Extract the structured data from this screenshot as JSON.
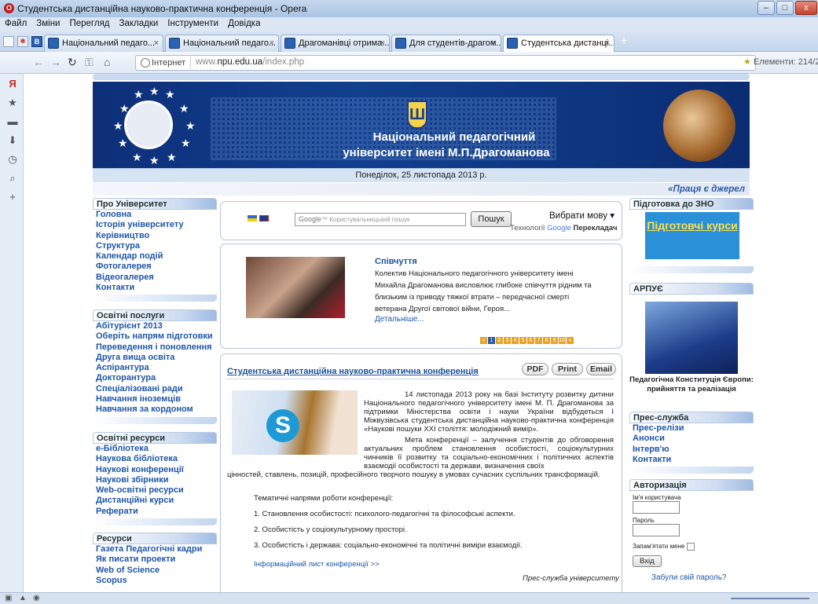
{
  "window": {
    "title": "Студентська дистанційна науково-практична конференція - Opera",
    "controls": [
      "–",
      "□",
      "x"
    ]
  },
  "menu": [
    "Файл",
    "Зміни",
    "Перегляд",
    "Закладки",
    "Інструменти",
    "Довідка"
  ],
  "tabs": [
    {
      "label": "Національний педаго...",
      "active": false
    },
    {
      "label": "Національний педаго...",
      "active": false
    },
    {
      "label": "Драгоманівці отрима...",
      "active": false
    },
    {
      "label": "Для студентів-драгом...",
      "active": false
    },
    {
      "label": "Студентська дистанці...",
      "active": true
    }
  ],
  "address": {
    "security_label": "Інтернет",
    "url_prefix": "www.",
    "url_domain": "npu.edu.ua",
    "url_path": "/index.php",
    "elements_label": "Елементи: 214/2"
  },
  "site": {
    "university_line1": "Національний педагогічний",
    "university_line2": "університет імені М.П.Драгоманова",
    "date": "Понеділок, 25 листопада 2013 р.",
    "ticker": "«Праця є джерел"
  },
  "left_blocks": [
    {
      "title": "Про Університет",
      "links": [
        "Головна",
        "Історія університету",
        "Керівництво",
        "Структура",
        "Календар подій",
        "Фотогалерея",
        "Відеогалерея",
        "Контакти"
      ]
    },
    {
      "title": "Освітні послуги",
      "links": [
        "Абітурієнт 2013",
        "Оберіть напрям підготовки",
        "Переведення і поновлення",
        "Друга вища освіта",
        "Аспірантура",
        "Докторантура",
        "Спеціалізовані ради",
        "Навчання іноземців",
        "Навчання за кордоном"
      ]
    },
    {
      "title": "Освітні ресурси",
      "links": [
        "e-Бібліотека",
        "Наукова бібліотека",
        "Наукові конференції",
        "Наукові збірники",
        "Web-освітні ресурси",
        "Дистанційні курси",
        "Реферати"
      ]
    },
    {
      "title": "Ресурси",
      "links": [
        "Газета Педагогічні кадри",
        "Як писати проекти",
        "Web of Science",
        "Scopus"
      ]
    }
  ],
  "search": {
    "placeholder": "Користувальницький пошук",
    "google_label": "Google",
    "button": "Пошук",
    "language_select": "Вибрати мову ▾",
    "translate_prefix": "Технології",
    "translate_google": "Google",
    "translate_suffix": "Перекладач"
  },
  "news": {
    "title": "Співчуття",
    "text": "Колектив Національного педагогічного університету імені Михайла Драгоманова висловлює глибоке співчуття рідним та близьким із приводу тяжкої втрати – передчасної смерті ветерана Другої світової війни, Героя...",
    "more": "Детальніше...",
    "pages": [
      "«",
      "1",
      "2",
      "3",
      "4",
      "5",
      "6",
      "7",
      "8",
      "9",
      "10",
      "»"
    ]
  },
  "article": {
    "title": "Студентська дистанційна науково-практична конференція",
    "buttons": [
      "PDF",
      "Print",
      "Email"
    ],
    "para1": "14 листопада 2013 року на базі Інституту розвитку дитини Національного педагогічного університету імені М. П. Драгоманова за підтримки Міністерства освіти і науки України відбудеться І Міжвузівська студентська дистанційна науково-практична конференція «Наукові пошуки ХХІ століття: молодіжний вимір».",
    "para2a": "Мета конференції – залучення студентів до обговорення актуальних проблем становлення особистості, соціокультурних чинників її розвитку та соціально-економічних і політичних аспектів взаємодії особистості та держави, визначення своїх",
    "para2b": "цінностей, ставлень, позицій, професійного творчого пошуку в умовах сучасних суспільних трансформацій.",
    "directions_title": "Тематичні напрями роботи конференції:",
    "directions": [
      "1. Становлення особистості: психолого-педагогічні та філософські аспекти.",
      "2. Особистість у соціокультурному просторі.",
      "3. Особистість і держава: соціально-економічні та політичні виміри взаємодії."
    ],
    "info_link": "Інформаційний лист конференції >>",
    "signature": "Прес-служба університету"
  },
  "right": {
    "zno_title": "Підготовка до ЗНО",
    "zno_banner": "Підготовчі курси",
    "arpue_title": "АРПУЄ",
    "arpue_caption": "Педагогічна Конституція Європи: прийняття та реалізація",
    "press_title": "Прес-служба",
    "press_links": [
      "Прес-релізи",
      "Анонси",
      "Інтерв'ю",
      "Контакти"
    ],
    "auth_title": "Авторизація",
    "username_label": "Ім'я користувача",
    "password_label": "Пароль",
    "remember_label": "Запам'ятати мене",
    "login_button": "Вхід",
    "forgot_link": "Забули свій пароль?"
  }
}
